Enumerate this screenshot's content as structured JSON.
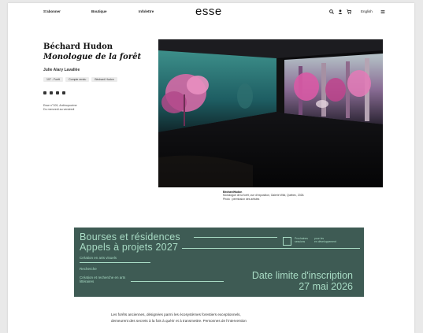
{
  "header": {
    "nav": [
      "S'abonner",
      "Boutique",
      "Infolettre"
    ],
    "logo": "esse",
    "lang": "English"
  },
  "article": {
    "artist": "Béchard Hudon",
    "title": "Monologue de la forêt",
    "author": "Julie Alary Lavallée",
    "tags": [
      "107 - Forêt",
      "Compte rendu",
      "Béchard Hudon"
    ],
    "issue_line1": "Esse n°109, Anthropocène",
    "issue_line2": "Du mercredi au vendredi"
  },
  "caption": {
    "credit": "BéchardHudon",
    "line1": "Monologue de la forêt, vue d'exposition, Galerie Wild, Québec, 2026.",
    "line2": "Photo : permission des artistes"
  },
  "banner": {
    "line1": "Bourses et résidences",
    "line2": "Appels à projets 2027",
    "sub1": "Création en arts visuels",
    "sub2": "Recherche",
    "sub3": "Création et recherche en arts littéraires",
    "deadline1": "Date limite d'inscription",
    "deadline2": "27 mai 2026",
    "small_left": "Prochaines\nsessions",
    "small_right": "pour les\nen développement"
  },
  "body": {
    "line1": "Les forêts anciennes, désignées parmi les écosystèmes forestiers exceptionnels,",
    "line2": "demeurent des secrets à la fois à quérir et à transmettre. Personnes de l'intervention"
  },
  "colors": {
    "banner_bg": "#3e5b54",
    "banner_fg": "#a9dcc5"
  }
}
